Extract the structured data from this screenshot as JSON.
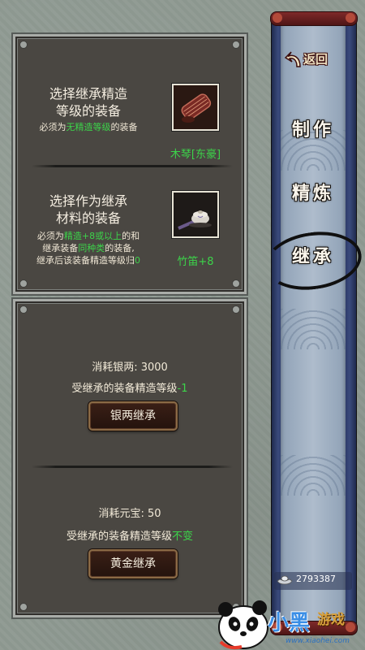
{
  "source_section": {
    "title": "选择继承精造\n等级的装备",
    "requirement_prefix": "必须为",
    "requirement_highlight": "无精造等级",
    "requirement_suffix": "的装备",
    "item_name": "木琴[东豪]"
  },
  "material_section": {
    "title": "选择作为继承\n材料的装备",
    "line1_prefix": "必须为",
    "line1_highlight": "精造+8或以上",
    "line1_suffix": "的和",
    "line2_prefix": "继承装备",
    "line2_highlight": "同种类",
    "line2_suffix": "的装备,",
    "line3_prefix": "继承后该装备精造等级归",
    "line3_highlight": "0",
    "item_name": "竹笛+8"
  },
  "silver_option": {
    "cost_label": "消耗银两: 3000",
    "effect_prefix": "受继承的装备精造等级",
    "effect_highlight": "-1",
    "button_label": "银两继承"
  },
  "gold_option": {
    "cost_label": "消耗元宝: 50",
    "effect_prefix": "受继承的装备精造等级",
    "effect_highlight": "不变",
    "button_label": "黄金继承"
  },
  "side_menu": {
    "back_label": "返回",
    "tabs": [
      {
        "label": "制作",
        "active": false
      },
      {
        "label": "精炼",
        "active": false
      },
      {
        "label": "继承",
        "active": true
      }
    ]
  },
  "currency": {
    "icon": "silver-ingot-icon",
    "value": "2793387"
  },
  "watermark": {
    "brand": "小黑",
    "brand_suffix": "游戏",
    "url": "www.xiaohei.com"
  },
  "colors": {
    "highlight_green": "#3cd44a",
    "panel_bg": "#4a4742",
    "scroll_blue": "#2c3968"
  }
}
